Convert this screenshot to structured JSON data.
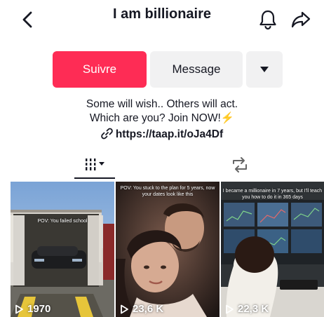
{
  "header": {
    "title": "I am billionaire",
    "back_icon": "chevron-left-icon",
    "bell_icon": "bell-icon",
    "share_icon": "share-arrow-icon"
  },
  "actions": {
    "follow_label": "Suivre",
    "message_label": "Message",
    "more_icon": "caret-down-icon",
    "follow_color": "#fe2c55"
  },
  "bio": {
    "line1": "Some will wish.. Others will act.",
    "line2": "Which are you? Join NOW!",
    "emoji": "⚡",
    "link": "https://taap.it/oJa4Df",
    "link_icon": "link-icon"
  },
  "tabs": {
    "videos_icon": "grid-bars-icon",
    "reposts_icon": "repost-icon",
    "active": "videos"
  },
  "videos": [
    {
      "caption": "POV: You failed school",
      "views": "1970"
    },
    {
      "caption": "POV: You stuck to the plan for 5 years, now your dates look like this",
      "views": "23,6 K"
    },
    {
      "caption": "I became a millionaire in 7 years, but I'll teach you how to do it in 365 days",
      "views": "22,3 K"
    }
  ]
}
